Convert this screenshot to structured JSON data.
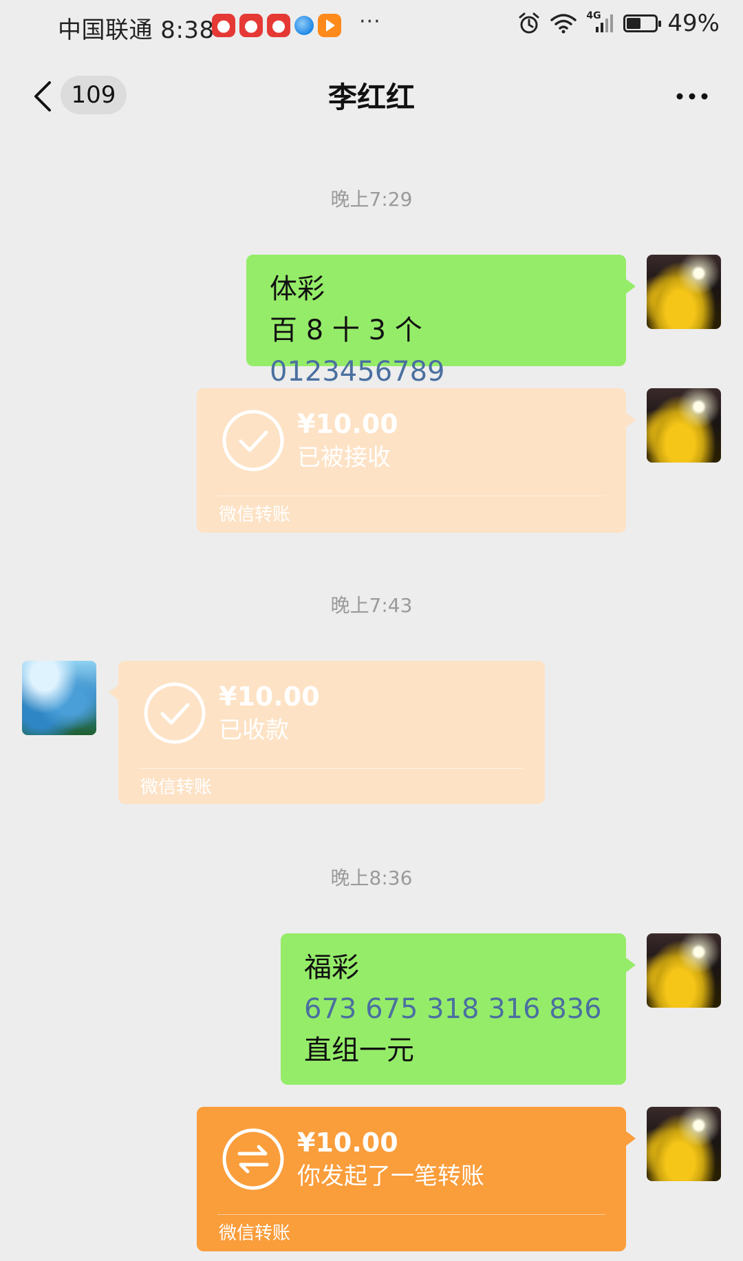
{
  "status_bar": {
    "carrier_time": "中国联通 8:38",
    "battery_text": "49%",
    "network_label": "4G",
    "notification_icons": [
      "clown-app-icon",
      "clown-app-icon",
      "clown-app-icon",
      "browser-globe-icon",
      "video-app-icon"
    ],
    "overflow": "···"
  },
  "nav": {
    "unread_count": "109",
    "title": "李红红"
  },
  "messages": {
    "time_1": "晚上7:29",
    "msg1_line1": "体彩",
    "msg1_line2_prefix": "百 8 十 3 个 ",
    "msg1_line2_number": "0123456789",
    "transfer1": {
      "amount": "¥10.00",
      "status": "已被接收",
      "footer": "微信转账"
    },
    "time_2": "晚上7:43",
    "transfer2": {
      "amount": "¥10.00",
      "status": "已收款",
      "footer": "微信转账"
    },
    "time_3": "晚上8:36",
    "msg2_line1": "福彩",
    "msg2_line2": "673 675 318 316 836",
    "msg2_line3": "直组一元",
    "transfer3": {
      "amount": "¥10.00",
      "status": "你发起了一笔转账",
      "footer": "微信转账"
    }
  },
  "colors": {
    "background": "#ededed",
    "bubble_green": "#95ec69",
    "transfer_received": "#fde2c5",
    "transfer_active": "#fa9d3b",
    "link_number": "#4a6fa0",
    "timestamp": "#9a9a9a"
  }
}
